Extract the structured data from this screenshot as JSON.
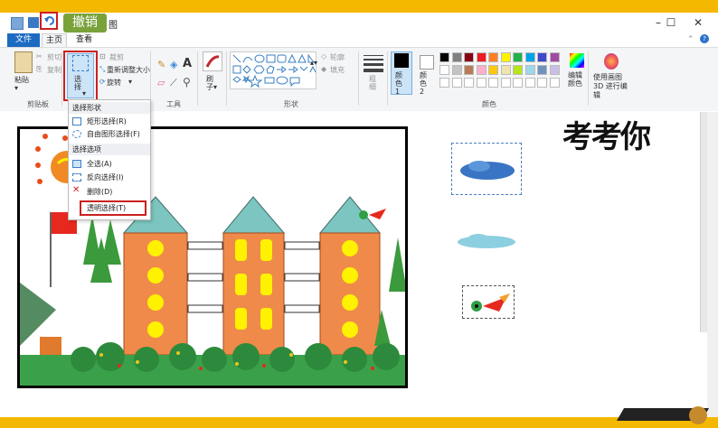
{
  "callout": {
    "label": "撤销"
  },
  "window": {
    "title_fragment": "图"
  },
  "tabs": [
    {
      "label": "文件"
    },
    {
      "label": "主页"
    },
    {
      "label": "查看"
    }
  ],
  "clipboard": {
    "paste": "粘贴",
    "cut": "剪切",
    "copy": "复制",
    "group": "剪贴板"
  },
  "image": {
    "select": "选择",
    "crop": "裁剪",
    "resize": "重新调整大小",
    "rotate": "旋转"
  },
  "tools": {
    "group": "工具"
  },
  "brushes": {
    "label": "刷子"
  },
  "shapes": {
    "outline": "轮廓",
    "fill": "填充",
    "group": "形状"
  },
  "size": {
    "label": "粗细"
  },
  "colors": {
    "color1": "颜色 1",
    "color2": "颜色 2",
    "edit": "编辑颜色",
    "group": "颜色",
    "palette": [
      "#000000",
      "#7f7f7f",
      "#880015",
      "#ed1c24",
      "#ff7f27",
      "#fff200",
      "#22b14c",
      "#00a2e8",
      "#3f48cc",
      "#a349a4",
      "#ffffff",
      "#c3c3c3",
      "#b97a57",
      "#ffaec9",
      "#ffc90e",
      "#efe4b0",
      "#b5e61d",
      "#99d9ea",
      "#7092be",
      "#c8bfe7"
    ]
  },
  "paint3d": {
    "label": "使用画图 3D 进行编辑"
  },
  "dropdown": {
    "section1": "选择形状",
    "rect": "矩形选择(R)",
    "free": "自由图形选择(F)",
    "section2": "选择选项",
    "all": "全选(A)",
    "invert": "反向选择(I)",
    "delete": "删除(D)",
    "transparent": "透明选择(T)"
  },
  "drawing": {
    "handwriting": "考考你"
  }
}
